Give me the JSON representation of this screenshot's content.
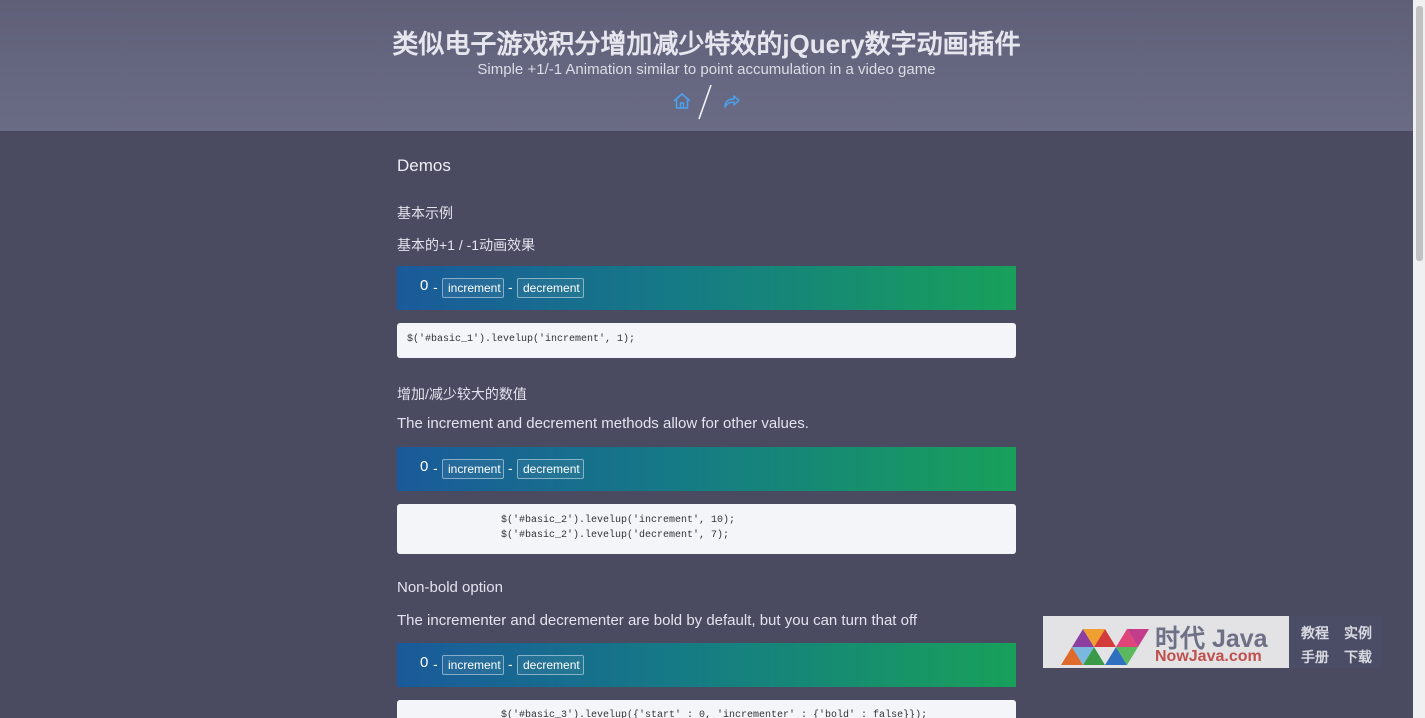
{
  "header": {
    "title": "类似电子游戏积分增加减少特效的jQuery数字动画插件",
    "subtitle": "Simple +1/-1 Animation similar to point accumulation in a video game",
    "icons": [
      "home-icon",
      "share-icon"
    ]
  },
  "content": {
    "demos_heading": "Demos",
    "section1": {
      "heading": "基本示例",
      "subheading": "基本的+1 / -1动画效果",
      "demo": {
        "counter": "0",
        "dash": "-",
        "increment_label": "increment",
        "decrement_label": "decrement"
      },
      "code": [
        "$('#basic_1').levelup('increment', 1);"
      ]
    },
    "section2": {
      "heading": "增加/减少较大的数值",
      "para": "The increment and decrement methods allow for other values.",
      "demo": {
        "counter": "0",
        "dash": "-",
        "increment_label": "increment",
        "decrement_label": "decrement"
      },
      "code": [
        "$('#basic_2').levelup('increment', 10);",
        "$('#basic_2').levelup('decrement', 7);"
      ]
    },
    "section3": {
      "heading": "Non-bold option",
      "para": "The incrementer and decrementer are bold by default, but you can turn that off",
      "demo": {
        "counter": "0",
        "dash": "-",
        "increment_label": "increment",
        "decrement_label": "decrement"
      },
      "code": [
        "$('#basic_3').levelup({'start' : 0, 'incrementer' : {'bold' : false}});"
      ]
    }
  },
  "watermark": {
    "title": "时代 Java",
    "url": "NowJava.com",
    "tags": [
      "教程",
      "实例",
      "手册",
      "下载"
    ]
  },
  "colors": {
    "background": "#4a4a61",
    "header": "#64657e",
    "demo_gradient_start": "#1a5a9a",
    "demo_gradient_end": "#18a05a"
  }
}
